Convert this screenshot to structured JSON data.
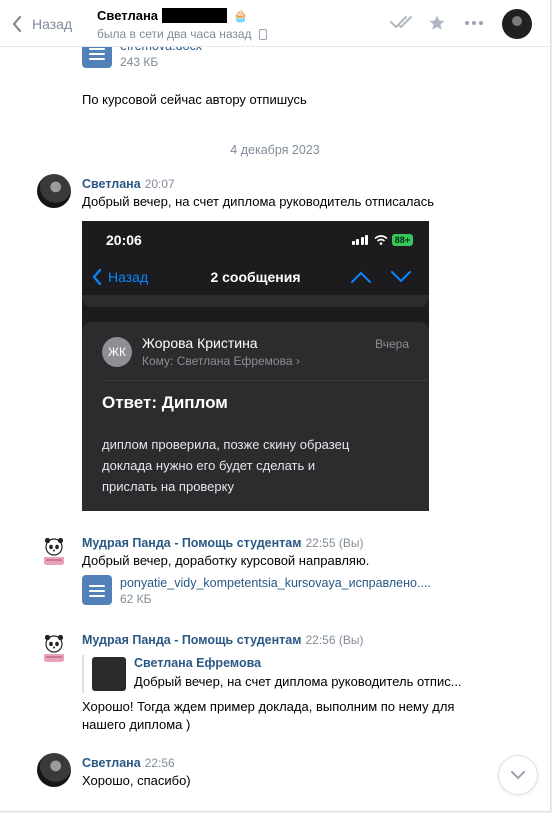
{
  "header": {
    "back_label": "Назад",
    "peer_name": "Светлана",
    "status": "была в сети два часа назад"
  },
  "messages": {
    "top_doc": {
      "name": "efremova.docx",
      "size": "243 КБ"
    },
    "top_text": "По курсовой сейчас автору отпишусь",
    "date_sep": "4 декабря 2023",
    "m1": {
      "author": "Светлана",
      "time": "20:07",
      "text": "Добрый вечер, на счет диплома руководитель отписалась"
    },
    "m2": {
      "author": "Мудрая Панда - Помощь студентам",
      "time": "22:55 (Вы)",
      "text": "Добрый вечер, доработку курсовой направляю.",
      "doc_name": "ponyatie_vidy_kompetentsia_kursovaya_исправлено....",
      "doc_size": "62 КБ"
    },
    "m3": {
      "author": "Мудрая Панда - Помощь студентам",
      "time": "22:56 (Вы)",
      "reply_author": "Светлана Ефремова",
      "reply_text": "Добрый вечер, на счет диплома руководитель отпис...",
      "text": "Хорошо! Тогда ждем пример доклада, выполним по нему для нашего диплома )"
    },
    "m4": {
      "author": "Светлана",
      "time": "22:56",
      "text": "Хорошо, спасибо)"
    }
  },
  "screenshot": {
    "status_time": "20:06",
    "battery": "88+",
    "nav_back": "Назад",
    "nav_title": "2 сообщения",
    "initials": "ЖК",
    "sender": "Жорова Кристина",
    "to_label": "Кому:",
    "to_name": "Светлана Ефремова",
    "when": "Вчера",
    "subject": "Ответ: Диплом",
    "body": "диплом проверила, позже скину образец\n доклада нужно его будет сделать и\nприслать на проверку"
  },
  "colors": {
    "link": "#2a5885",
    "accent": "#5181b8",
    "muted": "#818c99",
    "ios_blue": "#0a84ff"
  },
  "icons": [
    "chevron-left-icon",
    "read-checks-icon",
    "star-icon",
    "more-icon",
    "phone-icon",
    "doc-icon",
    "chevron-down-icon"
  ]
}
